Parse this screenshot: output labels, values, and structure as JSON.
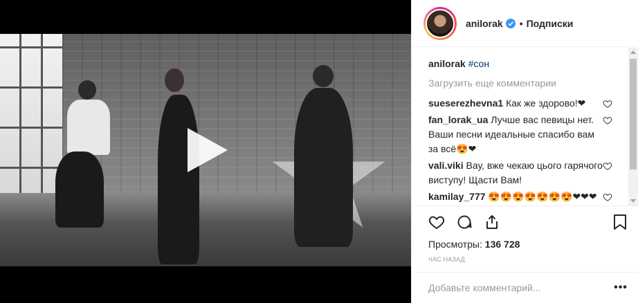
{
  "author": {
    "username": "anilorak",
    "verified": true,
    "separator": "•",
    "follow_label": "Подписки"
  },
  "caption": {
    "username": "anilorak",
    "hashtag": "#сон"
  },
  "load_more": "Загрузить еще комментарии",
  "comments": [
    {
      "user": "sueserezhevna1",
      "text": "Как же здорово!❤"
    },
    {
      "user": "fan_lorak_ua",
      "text": "Лучше вас певицы нет. Ваши песни идеальные спасибо вам за всё😍❤"
    },
    {
      "user": "vali.viki",
      "text": "Вау, вже чекаю цього гарячого виступу! Щасти Вам!"
    },
    {
      "user": "kamilay_777",
      "text": "😍😍😍😍😍😍😍❤❤❤❤❤❤❤❤❤🔥🔥🔥🔥🔥🔥🔥🔥🔥"
    }
  ],
  "stats": {
    "views_label": "Просмотры:",
    "views_count": "136 728",
    "time": "час назад"
  },
  "add_comment": {
    "placeholder": "Добавьте комментарий..."
  },
  "more_label": "•••",
  "icons": [
    "play-icon",
    "heart-icon",
    "comment-icon",
    "share-icon",
    "bookmark-icon",
    "verified-icon",
    "more-icon"
  ],
  "colors": {
    "accent_link": "#003569",
    "muted": "#999999",
    "text": "#262626",
    "verified_blue": "#3897f0"
  }
}
